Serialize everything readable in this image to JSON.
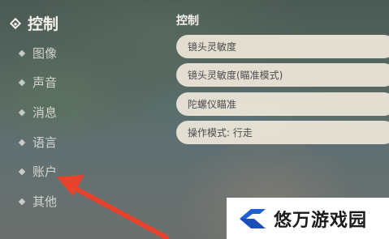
{
  "sidebar": {
    "items": [
      {
        "label": "控制",
        "active": true
      },
      {
        "label": "图像"
      },
      {
        "label": "声音"
      },
      {
        "label": "消息"
      },
      {
        "label": "语言"
      },
      {
        "label": "账户"
      },
      {
        "label": "其他"
      }
    ]
  },
  "main": {
    "section_title": "控制",
    "options": [
      {
        "label": "镜头灵敏度"
      },
      {
        "label": "镜头灵敏度(瞄准模式)"
      },
      {
        "label": "陀螺仪瞄准"
      },
      {
        "label": "操作模式: 行走"
      }
    ]
  },
  "annotation": {
    "icon": "red-arrow-icon",
    "color": "#e8412c"
  },
  "watermark": {
    "text": "悠万游戏园",
    "logo_color": "#1f5fd6"
  }
}
